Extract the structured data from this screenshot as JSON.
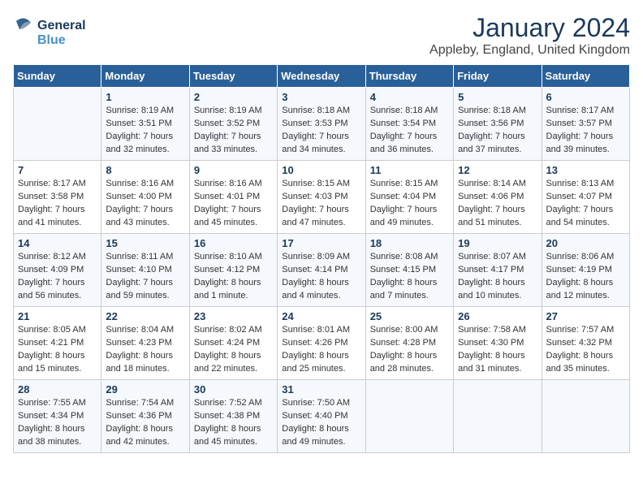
{
  "logo": {
    "line1": "General",
    "line2": "Blue"
  },
  "title": "January 2024",
  "location": "Appleby, England, United Kingdom",
  "days_header": [
    "Sunday",
    "Monday",
    "Tuesday",
    "Wednesday",
    "Thursday",
    "Friday",
    "Saturday"
  ],
  "weeks": [
    [
      {
        "num": "",
        "info": ""
      },
      {
        "num": "1",
        "info": "Sunrise: 8:19 AM\nSunset: 3:51 PM\nDaylight: 7 hours\nand 32 minutes."
      },
      {
        "num": "2",
        "info": "Sunrise: 8:19 AM\nSunset: 3:52 PM\nDaylight: 7 hours\nand 33 minutes."
      },
      {
        "num": "3",
        "info": "Sunrise: 8:18 AM\nSunset: 3:53 PM\nDaylight: 7 hours\nand 34 minutes."
      },
      {
        "num": "4",
        "info": "Sunrise: 8:18 AM\nSunset: 3:54 PM\nDaylight: 7 hours\nand 36 minutes."
      },
      {
        "num": "5",
        "info": "Sunrise: 8:18 AM\nSunset: 3:56 PM\nDaylight: 7 hours\nand 37 minutes."
      },
      {
        "num": "6",
        "info": "Sunrise: 8:17 AM\nSunset: 3:57 PM\nDaylight: 7 hours\nand 39 minutes."
      }
    ],
    [
      {
        "num": "7",
        "info": "Sunrise: 8:17 AM\nSunset: 3:58 PM\nDaylight: 7 hours\nand 41 minutes."
      },
      {
        "num": "8",
        "info": "Sunrise: 8:16 AM\nSunset: 4:00 PM\nDaylight: 7 hours\nand 43 minutes."
      },
      {
        "num": "9",
        "info": "Sunrise: 8:16 AM\nSunset: 4:01 PM\nDaylight: 7 hours\nand 45 minutes."
      },
      {
        "num": "10",
        "info": "Sunrise: 8:15 AM\nSunset: 4:03 PM\nDaylight: 7 hours\nand 47 minutes."
      },
      {
        "num": "11",
        "info": "Sunrise: 8:15 AM\nSunset: 4:04 PM\nDaylight: 7 hours\nand 49 minutes."
      },
      {
        "num": "12",
        "info": "Sunrise: 8:14 AM\nSunset: 4:06 PM\nDaylight: 7 hours\nand 51 minutes."
      },
      {
        "num": "13",
        "info": "Sunrise: 8:13 AM\nSunset: 4:07 PM\nDaylight: 7 hours\nand 54 minutes."
      }
    ],
    [
      {
        "num": "14",
        "info": "Sunrise: 8:12 AM\nSunset: 4:09 PM\nDaylight: 7 hours\nand 56 minutes."
      },
      {
        "num": "15",
        "info": "Sunrise: 8:11 AM\nSunset: 4:10 PM\nDaylight: 7 hours\nand 59 minutes."
      },
      {
        "num": "16",
        "info": "Sunrise: 8:10 AM\nSunset: 4:12 PM\nDaylight: 8 hours\nand 1 minute."
      },
      {
        "num": "17",
        "info": "Sunrise: 8:09 AM\nSunset: 4:14 PM\nDaylight: 8 hours\nand 4 minutes."
      },
      {
        "num": "18",
        "info": "Sunrise: 8:08 AM\nSunset: 4:15 PM\nDaylight: 8 hours\nand 7 minutes."
      },
      {
        "num": "19",
        "info": "Sunrise: 8:07 AM\nSunset: 4:17 PM\nDaylight: 8 hours\nand 10 minutes."
      },
      {
        "num": "20",
        "info": "Sunrise: 8:06 AM\nSunset: 4:19 PM\nDaylight: 8 hours\nand 12 minutes."
      }
    ],
    [
      {
        "num": "21",
        "info": "Sunrise: 8:05 AM\nSunset: 4:21 PM\nDaylight: 8 hours\nand 15 minutes."
      },
      {
        "num": "22",
        "info": "Sunrise: 8:04 AM\nSunset: 4:23 PM\nDaylight: 8 hours\nand 18 minutes."
      },
      {
        "num": "23",
        "info": "Sunrise: 8:02 AM\nSunset: 4:24 PM\nDaylight: 8 hours\nand 22 minutes."
      },
      {
        "num": "24",
        "info": "Sunrise: 8:01 AM\nSunset: 4:26 PM\nDaylight: 8 hours\nand 25 minutes."
      },
      {
        "num": "25",
        "info": "Sunrise: 8:00 AM\nSunset: 4:28 PM\nDaylight: 8 hours\nand 28 minutes."
      },
      {
        "num": "26",
        "info": "Sunrise: 7:58 AM\nSunset: 4:30 PM\nDaylight: 8 hours\nand 31 minutes."
      },
      {
        "num": "27",
        "info": "Sunrise: 7:57 AM\nSunset: 4:32 PM\nDaylight: 8 hours\nand 35 minutes."
      }
    ],
    [
      {
        "num": "28",
        "info": "Sunrise: 7:55 AM\nSunset: 4:34 PM\nDaylight: 8 hours\nand 38 minutes."
      },
      {
        "num": "29",
        "info": "Sunrise: 7:54 AM\nSunset: 4:36 PM\nDaylight: 8 hours\nand 42 minutes."
      },
      {
        "num": "30",
        "info": "Sunrise: 7:52 AM\nSunset: 4:38 PM\nDaylight: 8 hours\nand 45 minutes."
      },
      {
        "num": "31",
        "info": "Sunrise: 7:50 AM\nSunset: 4:40 PM\nDaylight: 8 hours\nand 49 minutes."
      },
      {
        "num": "",
        "info": ""
      },
      {
        "num": "",
        "info": ""
      },
      {
        "num": "",
        "info": ""
      }
    ]
  ]
}
